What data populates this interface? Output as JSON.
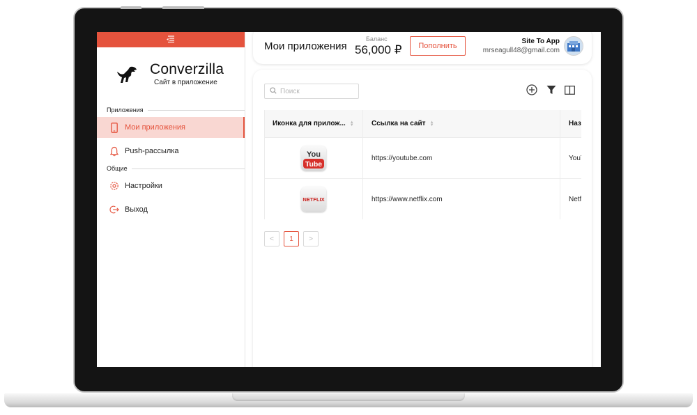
{
  "colors": {
    "accent": "#e5533d",
    "accent_light": "#f9d7d2"
  },
  "sidebar": {
    "top_icon": "collapse-menu-icon",
    "brand": {
      "name": "Converzilla",
      "subtitle": "Сайт в приложение"
    },
    "sections": [
      {
        "label": "Приложения"
      },
      {
        "label": "Общие"
      }
    ],
    "items": [
      {
        "label": "Мои приложения",
        "icon": "mobile-phone-icon",
        "active": true
      },
      {
        "label": "Push-рассылка",
        "icon": "bell-icon"
      },
      {
        "label": "Настройки",
        "icon": "gear-icon"
      },
      {
        "label": "Выход",
        "icon": "logout-icon"
      }
    ]
  },
  "header": {
    "title": "Мои приложения",
    "balance_label": "Баланс",
    "balance_value": "56,000 ₽",
    "topup_label": "Пополнить",
    "user_app": "Site To App",
    "user_email": "mrseagull48@gmail.com"
  },
  "content": {
    "search_placeholder": "Поиск",
    "toolbar_icons": [
      "add-circle-icon",
      "filter-icon",
      "columns-icon"
    ],
    "table": {
      "columns": [
        "Иконка для прилож...",
        "Ссылка на сайт",
        "Наз"
      ],
      "rows": [
        {
          "icon": "youtube-app-icon",
          "icon_text_top": "You",
          "icon_text_bottom": "Tube",
          "url": "https://youtube.com",
          "name": "YouT"
        },
        {
          "icon": "netflix-app-icon",
          "icon_text": "NETFLIX",
          "url": "https://www.netflix.com",
          "name": "Netf"
        }
      ]
    },
    "pagination": {
      "prev": "<",
      "current": "1",
      "next": ">"
    }
  }
}
